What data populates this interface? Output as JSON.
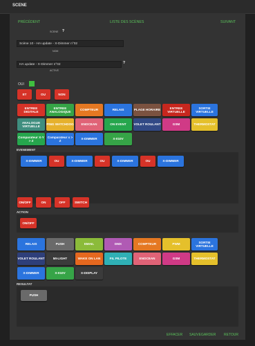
{
  "window": {
    "title": "SCENE"
  },
  "nav": {
    "previous": "PRÉCÉDENT",
    "list": "LISTE DES SCÈNES",
    "next": "SUIVANT"
  },
  "form": {
    "scene_label": "SCENE",
    "help_icon": "?",
    "scene_value": "Scène 10 - HA update - X-Dimmer n°02",
    "name_label": "NOM",
    "name_value": "HA update - X-Dimmer n°02",
    "active_label": "ACTIVE",
    "active_value": "OUI"
  },
  "logic_buttons": [
    "ET",
    "OU",
    "NON"
  ],
  "event_palette": [
    [
      "ENTREE DIGITALE",
      "ENTREE ANALOGIQUE",
      "COMPTEUR",
      "RELAIS",
      "PLAGE HORAIRE",
      "ENTREE VIRTUELLE",
      "SORTIE VIRTUELLE"
    ],
    [
      "ANALOGUE VIRTUELLE",
      "PING WATCHDOG",
      "ENOCEAN",
      "ON EVENT",
      "VOLET ROULANT",
      "GSM",
      "THERMOSTAT"
    ],
    [
      "Comparateur X-Y > Z",
      "Comparateur x > Z",
      "X-DIMMER",
      "X-010V"
    ]
  ],
  "evenement": {
    "title": "EVENEMENT",
    "tokens": [
      "X-DIMMER",
      "OU",
      "X-DIMMER",
      "OU",
      "X-DIMMER",
      "OU",
      "X-DIMMER"
    ]
  },
  "action_palette": [
    "ON/OFF",
    "ON",
    "OFF",
    "SWITCH"
  ],
  "action": {
    "title": "ACTION",
    "tokens": [
      "ON/OFF"
    ]
  },
  "result_palette": [
    [
      "RELAIS",
      "PUSH",
      "EMAIL",
      "DMX",
      "COMPTEUR",
      "PWM",
      "SORTIE VIRTUELLE"
    ],
    [
      "VOLET ROULANT",
      "MI-LIGHT",
      "WAKE ON LAN",
      "FIL PILOTE",
      "ENOCEAN",
      "GSM",
      "THERMOSTAT"
    ],
    [
      "X-DIMMER",
      "X-010V",
      "X-DISPLAY"
    ]
  ],
  "resultat": {
    "title": "RESULTAT",
    "tokens": [
      "PUSH"
    ]
  },
  "footer": {
    "clear": "EFFACER",
    "save": "SAUVEGARDER",
    "back": "RETOUR"
  },
  "colors": {
    "accent": "#5cc45c",
    "background": "#202020",
    "panel": "#333333"
  }
}
